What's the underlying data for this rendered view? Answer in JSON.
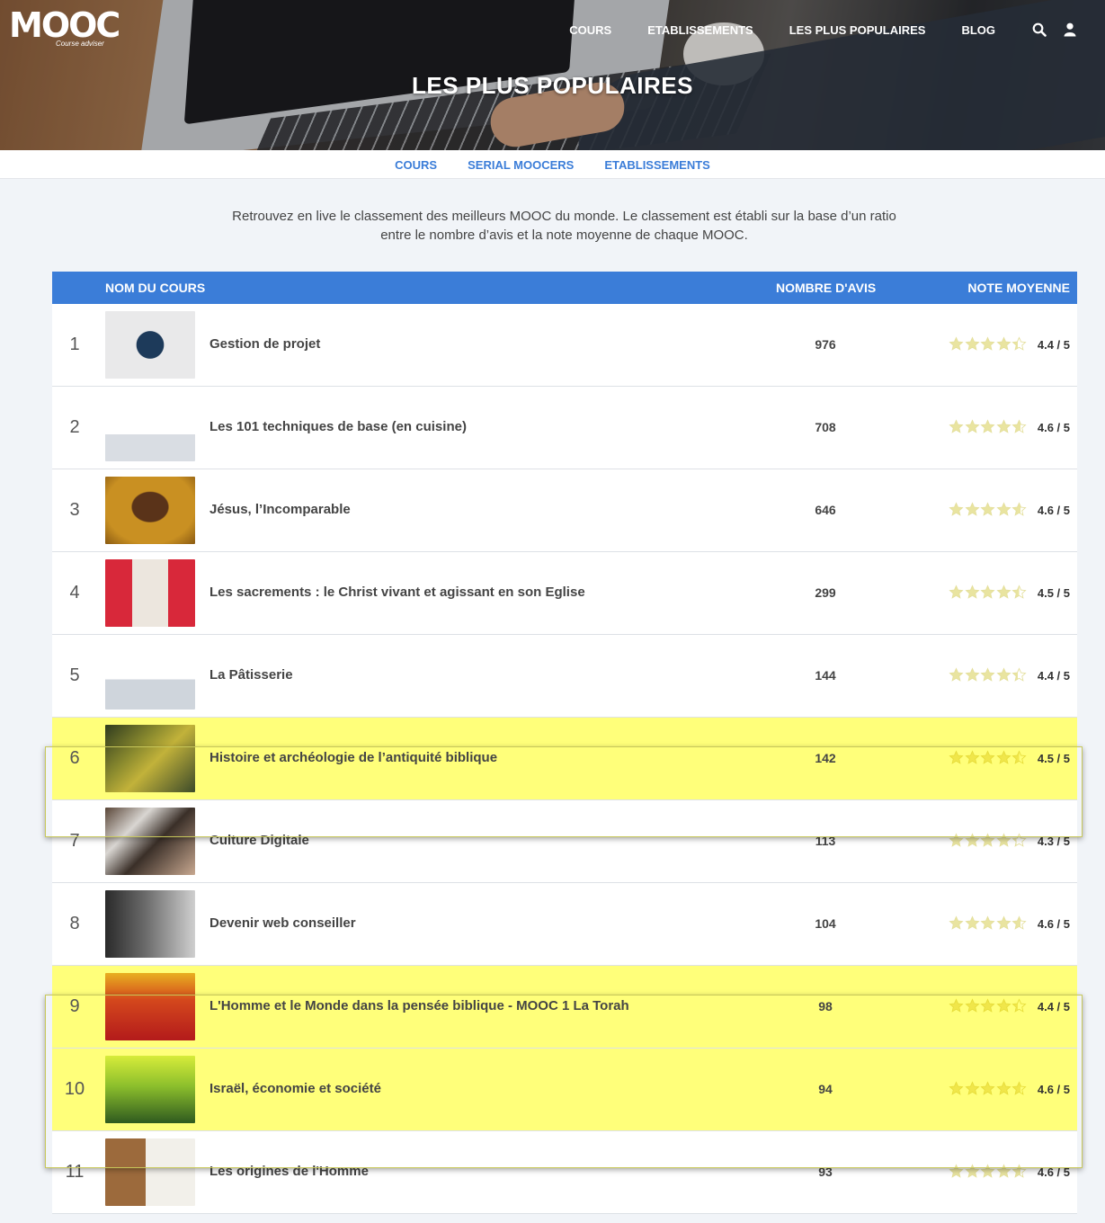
{
  "header": {
    "logo": "MOOC",
    "logo_tagline": "Course adviser",
    "nav": [
      "COURS",
      "ETABLISSEMENTS",
      "LES PLUS POPULAIRES",
      "BLOG"
    ],
    "icons": [
      "search-icon",
      "user-icon"
    ],
    "title": "LES PLUS POPULAIRES"
  },
  "tabs": [
    {
      "label": "COURS",
      "active": true
    },
    {
      "label": "SERIAL MOOCERS",
      "active": false
    },
    {
      "label": "ETABLISSEMENTS",
      "active": false
    }
  ],
  "intro": "Retrouvez en live le classement des meilleurs MOOC du monde. Le classement est établi sur la base d’un ratio entre le nombre d’avis et la note moyenne de chaque MOOC.",
  "table": {
    "col_name": "NOM DU COURS",
    "col_count": "NOMBRE D'AVIS",
    "col_rating": "NOTE MOYENNE",
    "rows": [
      {
        "rank": "1",
        "name": "Gestion de projet",
        "count": "976",
        "rating": "4.4 / 5",
        "stars": 4.4,
        "highlight": false
      },
      {
        "rank": "2",
        "name": "Les 101 techniques de base (en cuisine)",
        "count": "708",
        "rating": "4.6 / 5",
        "stars": 4.6,
        "highlight": false
      },
      {
        "rank": "3",
        "name": "Jésus, l’Incomparable",
        "count": "646",
        "rating": "4.6 / 5",
        "stars": 4.6,
        "highlight": false
      },
      {
        "rank": "4",
        "name": "Les sacrements : le Christ vivant et agissant en son Eglise",
        "count": "299",
        "rating": "4.5 / 5",
        "stars": 4.5,
        "highlight": false
      },
      {
        "rank": "5",
        "name": "La Pâtisserie",
        "count": "144",
        "rating": "4.4 / 5",
        "stars": 4.4,
        "highlight": false
      },
      {
        "rank": "6",
        "name": "Histoire et archéologie de l’antiquité biblique",
        "count": "142",
        "rating": "4.5 / 5",
        "stars": 4.5,
        "highlight": true
      },
      {
        "rank": "7",
        "name": "Culture Digitale",
        "count": "113",
        "rating": "4.3 / 5",
        "stars": 4.3,
        "highlight": false
      },
      {
        "rank": "8",
        "name": "Devenir web conseiller",
        "count": "104",
        "rating": "4.6 / 5",
        "stars": 4.6,
        "highlight": false
      },
      {
        "rank": "9",
        "name": "L'Homme et le Monde dans la pensée biblique - MOOC 1 La Torah",
        "count": "98",
        "rating": "4.4 / 5",
        "stars": 4.4,
        "highlight": true
      },
      {
        "rank": "10",
        "name": "Israël, économie et société",
        "count": "94",
        "rating": "4.6 / 5",
        "stars": 4.6,
        "highlight": true
      },
      {
        "rank": "11",
        "name": "Les origines de l'Homme",
        "count": "93",
        "rating": "4.6 / 5",
        "stars": 4.6,
        "highlight": false
      }
    ]
  },
  "colors": {
    "accent": "#3b7dd8",
    "highlight": "#ffff7a",
    "star": "#e9e4a0"
  }
}
